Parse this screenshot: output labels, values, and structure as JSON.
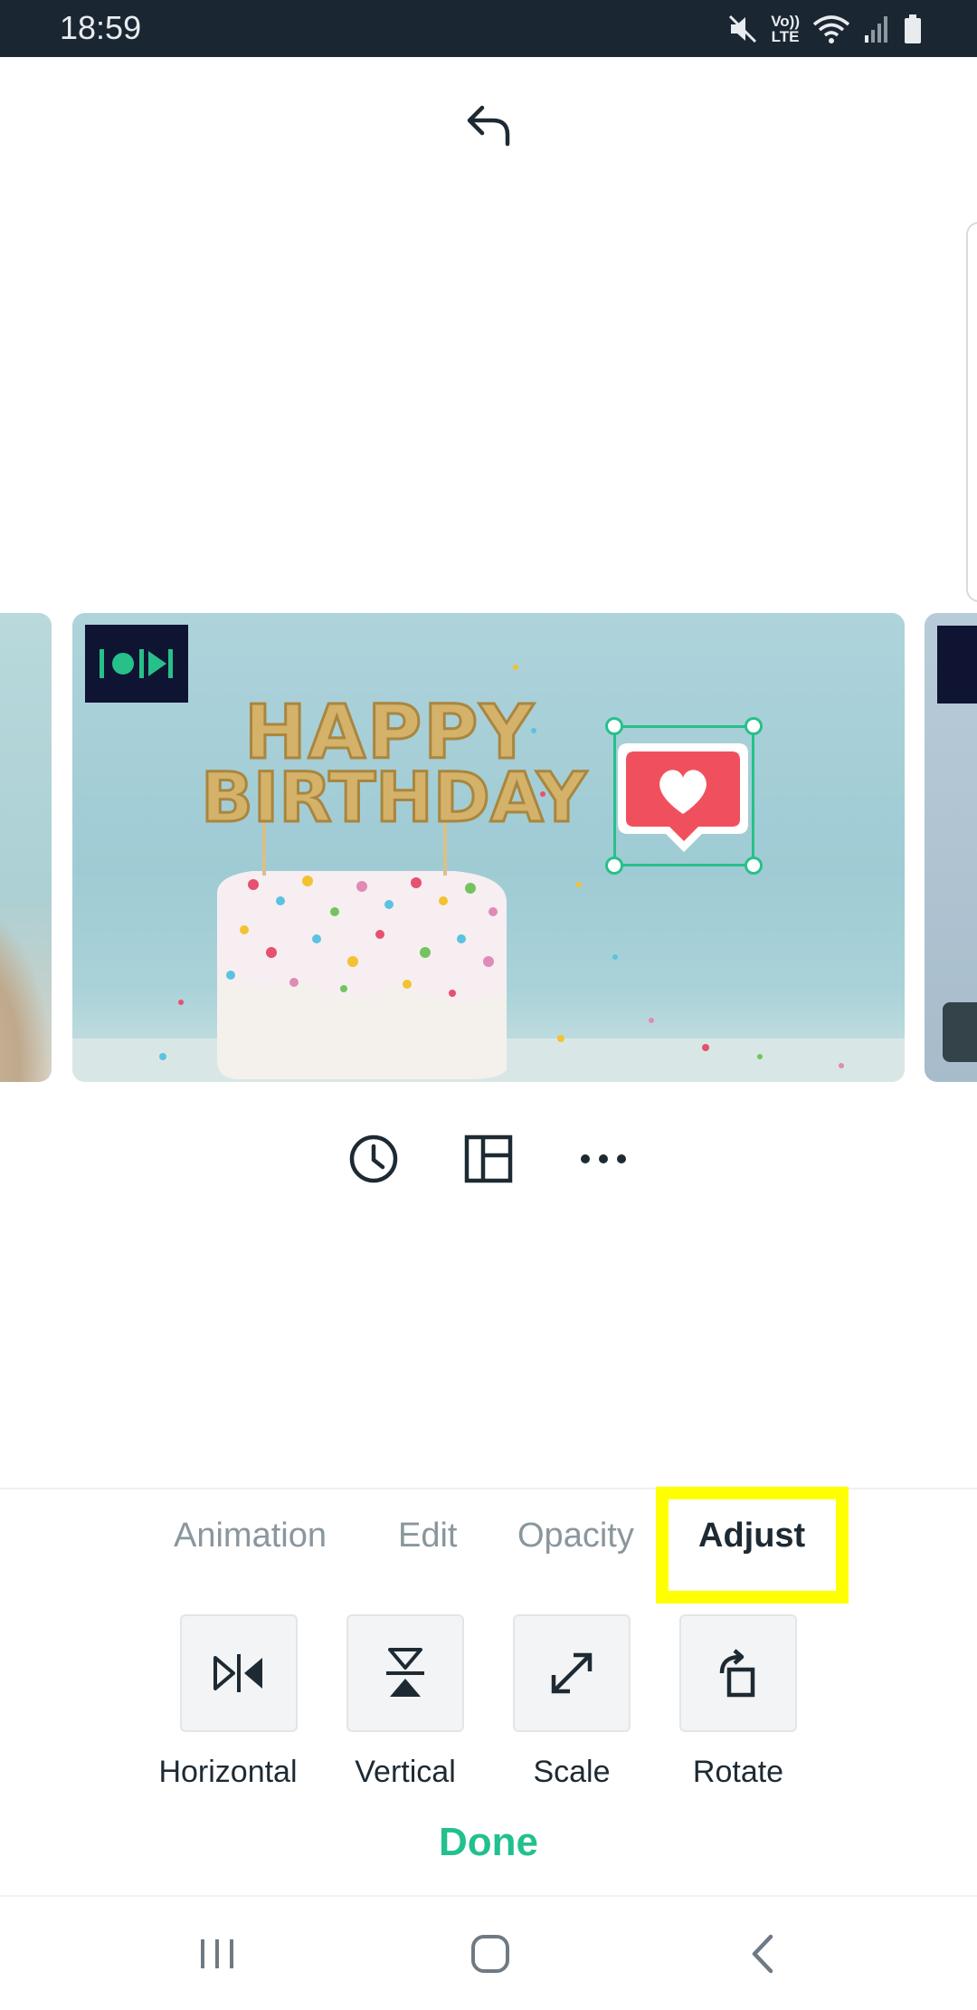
{
  "status_bar": {
    "time": "18:59",
    "volte_line1": "Vo))",
    "volte_line2": "LTE",
    "icons": [
      "mute-icon",
      "volte-icon",
      "wifi-icon",
      "signal-icon",
      "battery-icon"
    ]
  },
  "toolbar": {
    "undo_icon": "undo-icon"
  },
  "slide": {
    "badge_icon": "video-clip-icon",
    "text": "HAPPY BIRTHDAY",
    "sticker_icon": "heart-speech-bubble-sticker"
  },
  "slide_actions": [
    "clock-icon",
    "layout-icon",
    "more-icon"
  ],
  "panel": {
    "tabs": [
      {
        "label": "Animation",
        "active": false
      },
      {
        "label": "Edit",
        "active": false
      },
      {
        "label": "Opacity",
        "active": false
      },
      {
        "label": "Adjust",
        "active": true
      }
    ],
    "tools": [
      {
        "label": "Horizontal",
        "icon": "flip-horizontal-icon"
      },
      {
        "label": "Vertical",
        "icon": "flip-vertical-icon"
      },
      {
        "label": "Scale",
        "icon": "scale-icon"
      },
      {
        "label": "Rotate",
        "icon": "rotate-icon"
      }
    ],
    "done_label": "Done"
  },
  "nav_bar": [
    "recent-apps-icon",
    "home-icon",
    "back-icon"
  ],
  "colors": {
    "accent": "#22c08e",
    "status_bar": "#1b2633",
    "highlight": "#ffff00",
    "sticker": "#f0505e"
  }
}
